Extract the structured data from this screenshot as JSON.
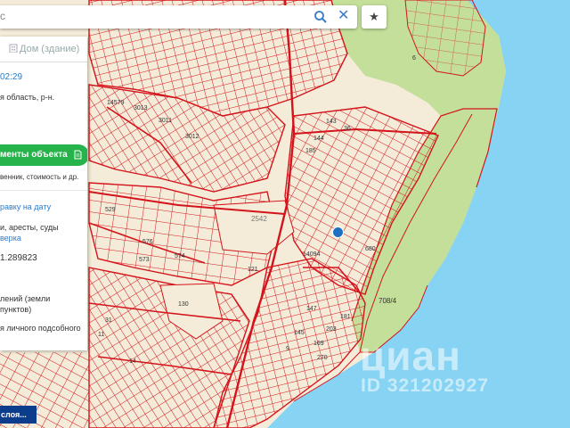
{
  "search": {
    "query": "с"
  },
  "panel": {
    "tab_label": "Дом (здание)",
    "time": "02:29",
    "region": "я область, р-н.",
    "docs_button": "менты объекта",
    "docs_sub": "венник, стоимость и др.",
    "ref_link": "равку на дату",
    "arrests": "и, аресты, суды",
    "check_link": "верка",
    "coords": "1.289823",
    "land_cat_1": "лений (земли",
    "land_cat_2": "пунктов)",
    "usage": "я личного подсобного"
  },
  "layers_button": "слоя...",
  "watermark": {
    "brand": "циан",
    "id_text": "ID 321202927"
  },
  "plots": [
    "2542",
    "14094",
    "121",
    "130",
    "529",
    "576",
    "574",
    "573",
    "3013",
    "3011",
    "3012",
    "14579",
    "143",
    "144",
    "36",
    "185",
    "680",
    "708/4",
    "6",
    "147",
    "145",
    "9",
    "169",
    "203",
    "270",
    "181",
    "11",
    "31",
    "14"
  ],
  "colors": {
    "water": "#86d3f4",
    "forest": "#c3df9a",
    "land": "#f4ecd8",
    "parcel": "#d4141c",
    "button_green": "#27b34b",
    "layers_bg": "#0b3d8c",
    "link": "#2b7bc8"
  }
}
